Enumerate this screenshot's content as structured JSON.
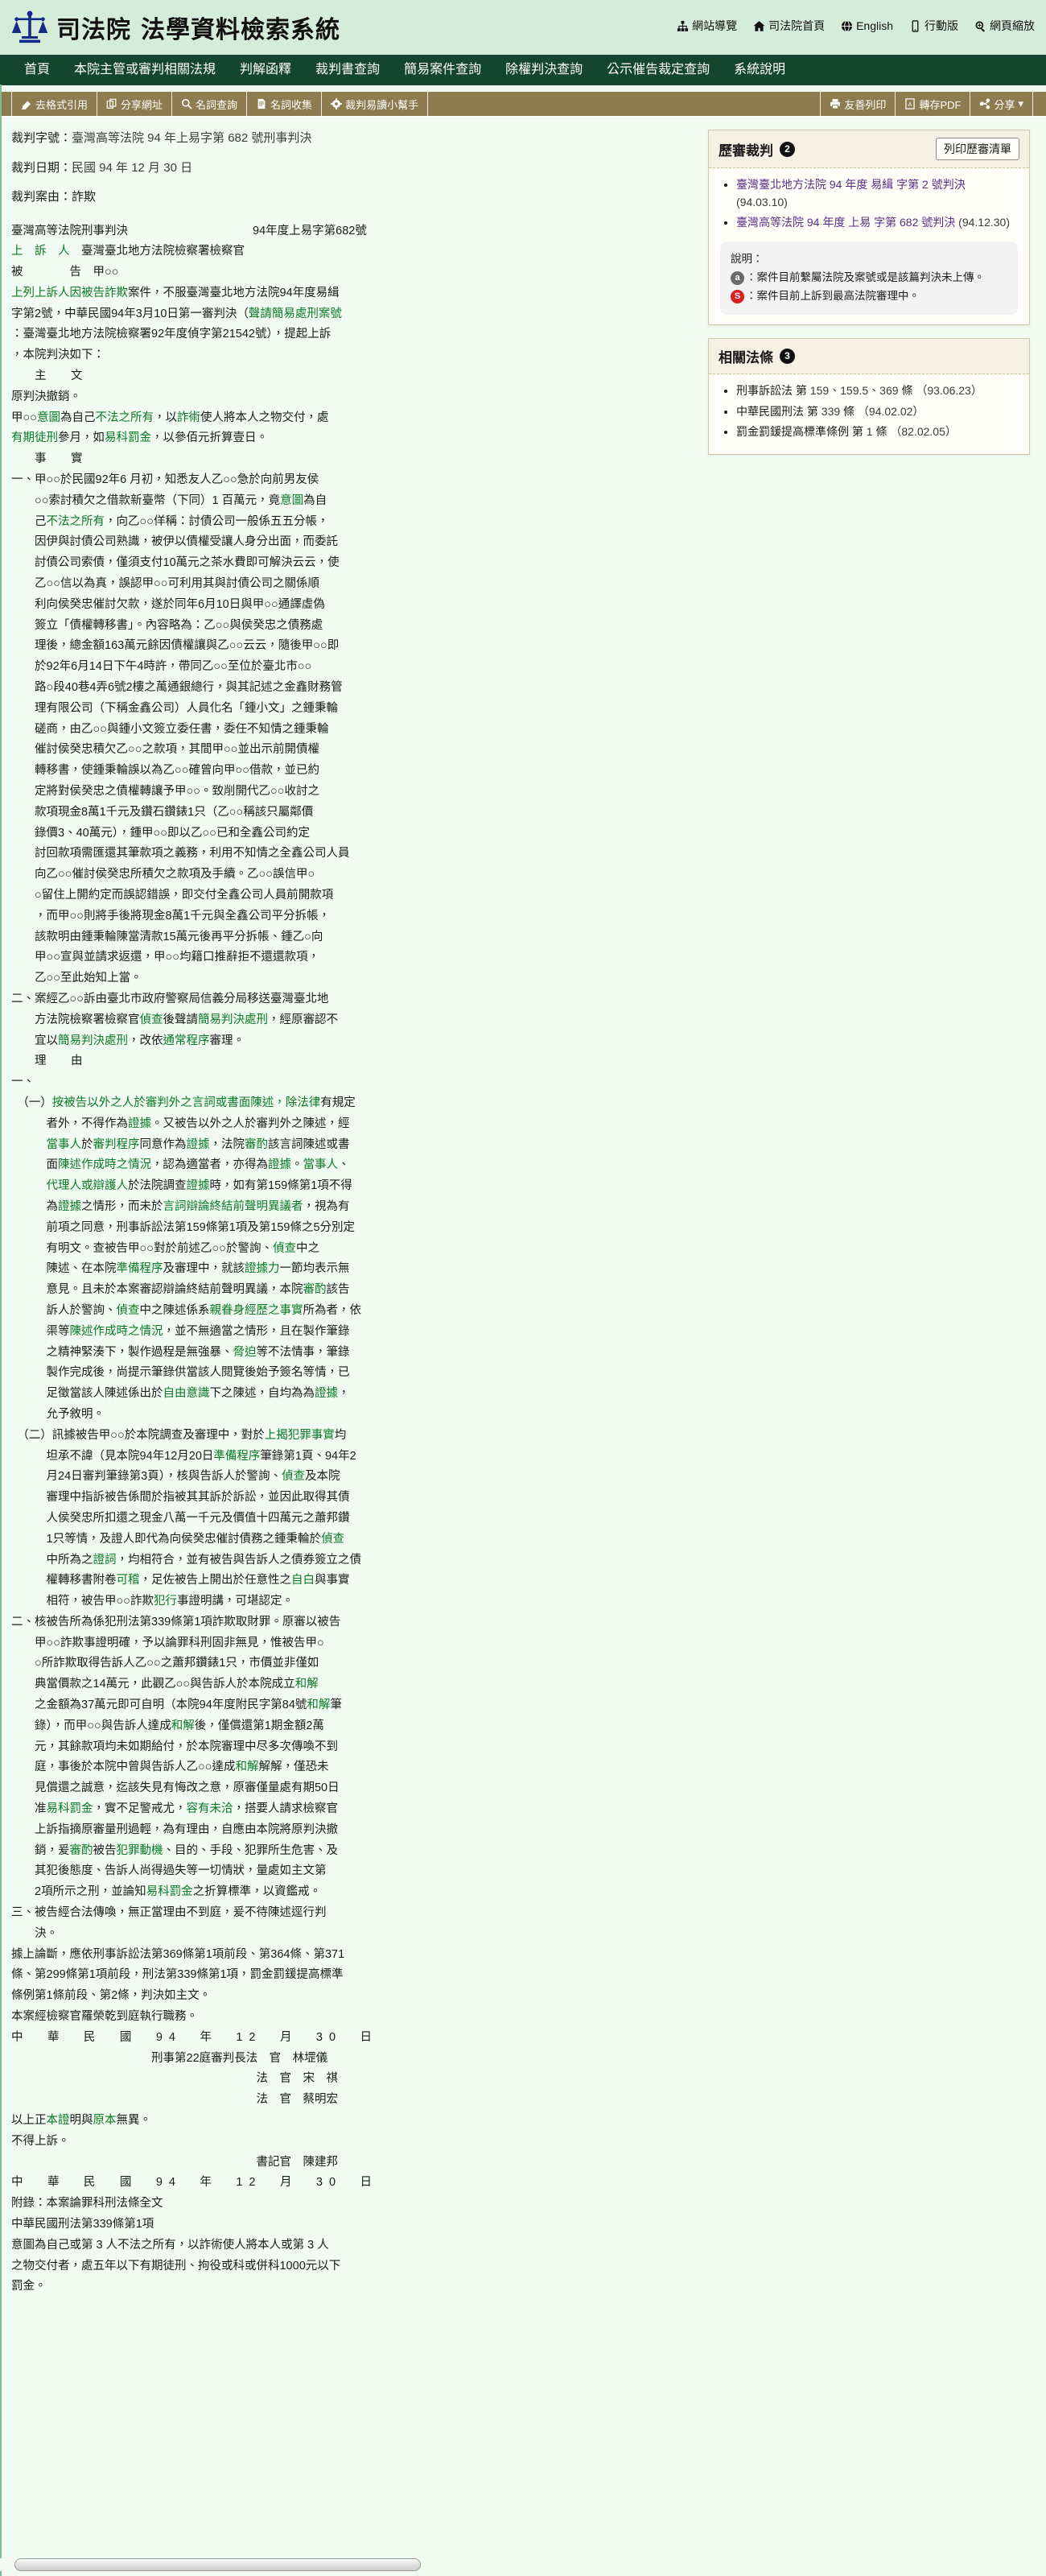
{
  "site": {
    "logo_alt": "scales-of-justice-logo",
    "name": "司法院",
    "system": "法學資料檢索系統"
  },
  "header_links": [
    {
      "icon": "sitemap-icon",
      "label": "網站導覽"
    },
    {
      "icon": "home-icon",
      "label": "司法院首頁"
    },
    {
      "icon": "globe-icon",
      "label": "English"
    },
    {
      "icon": "mobile-icon",
      "label": "行動版"
    },
    {
      "icon": "zoom-icon",
      "label": "網頁縮放"
    }
  ],
  "nav": [
    {
      "label": "首頁"
    },
    {
      "label": "本院主管或審判相關法規"
    },
    {
      "label": "判解函釋"
    },
    {
      "label": "裁判書查詢"
    },
    {
      "label": "簡易案件查詢"
    },
    {
      "label": "除權判決查詢"
    },
    {
      "label": "公示催告裁定查詢"
    },
    {
      "label": "系統說明"
    }
  ],
  "toolbar": {
    "left": [
      {
        "icon": "eraser-icon",
        "label": "去格式引用"
      },
      {
        "icon": "share-link-icon",
        "label": "分享網址"
      },
      {
        "icon": "search-icon",
        "label": "名詞查詢"
      },
      {
        "icon": "document-icon",
        "label": "名詞收集"
      },
      {
        "icon": "gear-icon",
        "label": "裁判易讀小幫手"
      }
    ],
    "right": [
      {
        "icon": "printer-icon",
        "label": "友善列印"
      },
      {
        "icon": "pdf-icon",
        "label": "轉存PDF"
      },
      {
        "icon": "share-icon",
        "label": "分享",
        "caret": "▾"
      }
    ]
  },
  "meta": {
    "case_no_label": "裁判字號：",
    "case_no_value": "臺灣高等法院 94 年上易字第 682 號刑事判決",
    "date_label": "裁判日期：",
    "date_value": "民國 94 年 12 月 30 日",
    "cause_label": "裁判案由：",
    "cause_value": "詐欺"
  },
  "document": {
    "title_left": "臺灣高等法院刑事判決",
    "title_right": "94年度上易字第682號",
    "parties": [
      {
        "role": "上　訴　人",
        "name": "臺灣臺北地方法院檢察署檢察官"
      },
      {
        "role": "被　　　　告",
        "name": "甲○○"
      }
    ],
    "preamble": [
      "上列上訴人因被告詐欺案件，不服臺灣臺北地方法院94年度易緝",
      "字第2號，中華民國94年3月10日第一審判決（聲請簡易處刑案號",
      "：臺灣臺北地方法院檢察署92年度偵字第21542號），提起上訴",
      "，本院判決如下："
    ],
    "sections": [
      {
        "heading": "主　文",
        "paragraphs": [
          "原判決撤銷。",
          "甲○○意圖為自己不法之所有，以詐術使人將本人之物交付，處",
          "有期徒刑參月，如易科罰金，以參佰元折算壹日。"
        ]
      },
      {
        "heading": "事　實",
        "paragraphs": [
          "一、甲○○於民國92年6 月初，知悉友人乙○○急於向前男友侯",
          "　　○○索討積欠之借款新臺幣（下同）1 百萬元，竟意圖為自",
          "　　己不法之所有，向乙○○佯稱：討債公司一般係五五分帳，",
          "　　因伊與討債公司熟識，被伊以債權受讓人身分出面，而委託",
          "　　討債公司索債，僅須支付10萬元之茶水費即可解決云云，使",
          "　　乙○○信以為真，誤認甲○○可利用其與討債公司之關係順",
          "　　利向侯癸忠催討欠款，遂於同年6月10日與甲○○通譯虛偽",
          "　　簽立「債權轉移書」。內容略為：乙○○與侯癸忠之債務處",
          "　　理後，總金額163萬元餘因債權讓與乙○○云云，隨後甲○○即",
          "　　於92年6月14日下午4時許，帶同乙○○至位於臺北市○○",
          "　　路○段40巷4弄6號2樓之萬通銀總行，與其記述之金鑫財務管",
          "　　理有限公司（下稱金鑫公司）人員化名「鍾小文」之鍾秉輪",
          "　　磋商，由乙○○與鍾小文簽立委任書，委任不知情之鍾秉輪",
          "　　催討侯癸忠積欠乙○○之款項，其間甲○○並出示前開債權",
          "　　轉移書，使鍾秉輪誤以為乙○○確曾向甲○○借款，並已約",
          "　　定將對侯癸忠之債權轉讓予甲○○。致削開代乙○○收討之",
          "　　款項現金8萬1千元及鑽石鑽錶1只（乙○○稱該只屬鄰價",
          "　　錄價3、40萬元），鍾甲○○即以乙○○已和全鑫公司約定",
          "　　討回款項需匯還其筆款項之義務，利用不知情之全鑫公司人員",
          "　　向乙○○催討侯癸忠所積欠之款項及手續。乙○○誤信甲○",
          "　　○留住上開約定而誤認錯誤，即交付全鑫公司人員前開款項",
          "　　，而甲○○則將手後將現金8萬1千元與全鑫公司平分拆帳，",
          "　　該款明由鍾秉輪陳當清款15萬元後再平分拆帳、鍾乙○向",
          "　　甲○○宣與並請求返還，甲○○均籍口推辭拒不還還款項，",
          "　　乙○○至此始知上當。",
          "二、案經乙○○訴由臺北市政府警察局信義分局移送臺灣臺北地",
          "　　方法院檢察署檢察官偵查後聲請簡易判決處刑，經原審認不",
          "　　宜以簡易判決處刑，改依通常程序審理。"
        ]
      },
      {
        "heading": "理　由",
        "paragraphs": [
          "一、",
          "　（一）按被告以外之人於審判外之言詞或書面陳述，除法律有規定",
          "　　　者外，不得作為證據。又被告以外之人於審判外之陳述，經",
          "　　　當事人於審判程序同意作為證據，法院審酌該言詞陳述或書",
          "　　　面陳述作成時之情況，認為適當者，亦得為證據。當事人、",
          "　　　代理人或辯護人於法院調查證據時，如有第159條第1項不得",
          "　　　為證據之情形，而未於言詞辯論終結前聲明異議者，視為有",
          "　　　前項之同意，刑事訴訟法第159條第1項及第159條之5分別定",
          "　　　有明文。查被告甲○○對於前述乙○○於警詢、偵查中之",
          "　　　陳述、在本院準備程序及審理中，就該證據力一節均表示無",
          "　　　意見。且未於本案審認辯論終結前聲明異議，本院審酌該告",
          "　　　訴人於警詢、偵查中之陳述係系親眷身經歷之事實所為者，依",
          "　　　渠等陳述作成時之情況，並不無適當之情形，且在製作筆錄",
          "　　　之精神緊湊下，製作過程是無強暴、脅迫等不法情事，筆錄",
          "　　　製作完成後，尚提示筆錄供當該人閱覽後始予簽名等情，已",
          "　　　足徵當該人陳述係出於自由意識下之陳述，自均為為證據，",
          "　　　允予敘明。",
          "　（二）訊據被告甲○○於本院調查及審理中，對於上揭犯罪事實均",
          "　　　坦承不諱（見本院94年12月20日準備程序筆錄第1頁、94年2",
          "　　　月24日審判筆錄第3頁），核與告訴人於警詢、偵查及本院",
          "　　　審理中指訴被告係間於指被其其訴於訴訟，並因此取得其債",
          "　　　人侯癸忠所扣還之現金八萬一千元及價值十四萬元之蕭邦鑽",
          "　　　1只等情，及證人即代為向侯癸忠催討債務之鍾秉輪於偵查",
          "　　　中所為之證詞，均相符合，並有被告與告訴人之債券簽立之債",
          "　　　權轉移書附卷可稽，足佐被告上開出於任意性之自白與事實",
          "　　　相符，被告甲○○詐欺犯行事證明講，可堪認定。",
          "二、核被告所為係犯刑法第339條第1項詐欺取財罪。原審以被告",
          "　　甲○○詐欺事證明確，予以論罪科刑固非無見，惟被告甲○",
          "　　○所詐欺取得告訴人乙○○之蕭邦鑽錶1只，市價並非僅如",
          "　　典當價款之14萬元，此觀乙○○與告訴人於本院成立和解",
          "　　之金額為37萬元即可自明（本院94年度附民字第84號和解筆",
          "　　錄），而甲○○與告訴人達成和解後，僅償還第1期金額2萬",
          "　　元，其餘款項均未如期給付，於本院審理中尽多次傳喚不到",
          "　　庭，事後於本院中曾與告訴人乙○○達成和解解解，僅恐未",
          "　　見償還之誠意，迄該失見有悔改之意，原審僅量處有期50日",
          "　　准易科罰金，實不足警戒尤，容有未洽，搭要人請求檢察官",
          "　　上訴指摘原審量刑過輕，為有理由，自應由本院將原判決撤",
          "　　銷，爰審酌被告犯罪動機、目的、手段、犯罪所生危害、及",
          "　　其犯後態度、告訴人尚得過失等一切情狀，量處如主文第",
          "　　2項所示之刑，並論知易科罰金之折算標準，以資鑑戒。",
          "三、被告經合法傳喚，無正當理由不到庭，爰不待陳述逕行判",
          "　　決。",
          "據上論斷，應依刑事訴訟法第369條第1項前段、第364條、第371",
          "條、第299條第1項前段，刑法第339條第1項，罰金罰鍰提高標準",
          "條例第1條前段、第2條，判決如主文。",
          "本案經檢察官羅榮乾到庭執行職務。"
        ]
      }
    ],
    "date_line_1": {
      "prefix": "中　華　民　國",
      "year": "94",
      "y": "年",
      "month": "12",
      "m": "月",
      "day": "30",
      "d": "日"
    },
    "signatures": [
      {
        "title": "刑事第22庭審判長法　官",
        "name": "林堽儀"
      },
      {
        "title": "法　官",
        "name": "宋　祺"
      },
      {
        "title": "法　官",
        "name": "蔡明宏"
      }
    ],
    "certify": "以上正本證明與原本無異。",
    "no_appeal": "不得上訴。",
    "clerk": {
      "title": "書記官",
      "name": "陳建邦"
    },
    "date_line_2": {
      "prefix": "中　華　民　國",
      "year": "94",
      "y": "年",
      "month": "12",
      "m": "月",
      "day": "30",
      "d": "日"
    },
    "appendix_title": "附錄：本案論罪科刑法條全文",
    "appendix_law": "中華民國刑法第339條第1項",
    "appendix_text": [
      "意圖為自己或第 3 人不法之所有，以詐術使人將本人或第 3 人",
      "之物交付者，處五年以下有期徒刑、拘役或科或併科1000元以下",
      "罰金。"
    ]
  },
  "side": {
    "history_panel": {
      "title": "歷審裁判",
      "count": "2",
      "print_button": "列印歷審清單",
      "items": [
        {
          "court": "臺灣臺北地方法院 94 年度 易緝 字第 2 號判決",
          "date": "(94.03.10)"
        },
        {
          "court": "臺灣高等法院 94 年度 上易 字第 682 號判決",
          "date": "(94.12.30)"
        }
      ],
      "note_title": "說明：",
      "notes": [
        {
          "icon": "a",
          "text": "：案件目前繫屬法院及案號或是該篇判決未上傳。"
        },
        {
          "icon": "S",
          "text": "：案件目前上訴到最高法院審理中。"
        }
      ]
    },
    "laws_panel": {
      "title": "相關法條",
      "count": "3",
      "items": [
        {
          "name": "刑事訴訟法 第",
          "articles": "159、159.5、369",
          "suffix": "條",
          "date": "（93.06.23）"
        },
        {
          "name": "中華民國刑法 第",
          "articles": "339",
          "suffix": "條",
          "date": "（94.02.02）"
        },
        {
          "name": "罰金罰鍰提高標準條例 第",
          "articles": "1",
          "suffix": "條",
          "date": "（82.02.05）"
        }
      ]
    }
  }
}
